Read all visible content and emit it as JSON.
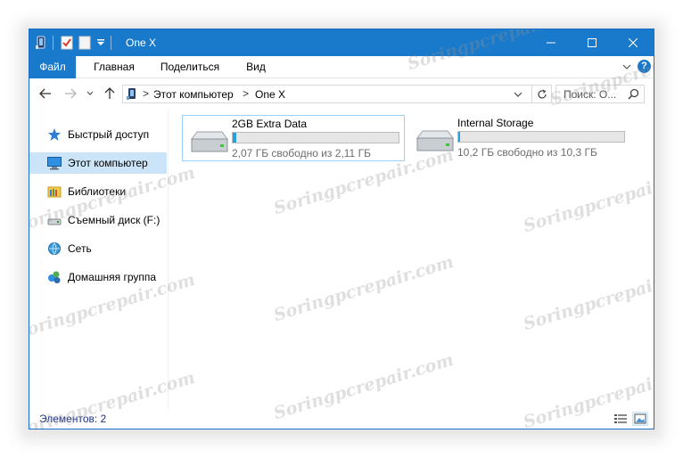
{
  "window": {
    "title": "One X"
  },
  "ribbon": {
    "file_label": "Файл",
    "tabs": [
      {
        "label": "Главная"
      },
      {
        "label": "Поделиться"
      },
      {
        "label": "Вид"
      }
    ],
    "help_label": "?"
  },
  "address": {
    "crumbs": [
      "Этот компьютер",
      "One X"
    ],
    "separator": ">"
  },
  "search": {
    "placeholder": "Поиск: О..."
  },
  "sidebar": {
    "items": [
      {
        "label": "Быстрый доступ",
        "icon": "star-icon",
        "selected": false
      },
      {
        "label": "Этот компьютер",
        "icon": "computer-icon",
        "selected": true
      },
      {
        "label": "Библиотеки",
        "icon": "library-icon",
        "selected": false
      },
      {
        "label": "Съемный диск (F:)",
        "icon": "removable-drive-icon",
        "selected": false
      },
      {
        "label": "Сеть",
        "icon": "network-icon",
        "selected": false
      },
      {
        "label": "Домашняя группа",
        "icon": "homegroup-icon",
        "selected": false
      }
    ]
  },
  "drives": [
    {
      "name": "2GB Extra Data",
      "free_text": "2,07 ГБ свободно из 2,11 ГБ",
      "used_fraction": 0.02,
      "selected": true
    },
    {
      "name": "Internal Storage",
      "free_text": "10,2 ГБ свободно из 10,3 ГБ",
      "used_fraction": 0.01,
      "selected": false
    }
  ],
  "status": {
    "items_count": "Элементов: 2"
  },
  "watermark": {
    "text": "Soringpcrepair.com"
  },
  "colors": {
    "accent": "#1979ca",
    "selection": "#cce4f7",
    "progress": "#26a0da"
  }
}
